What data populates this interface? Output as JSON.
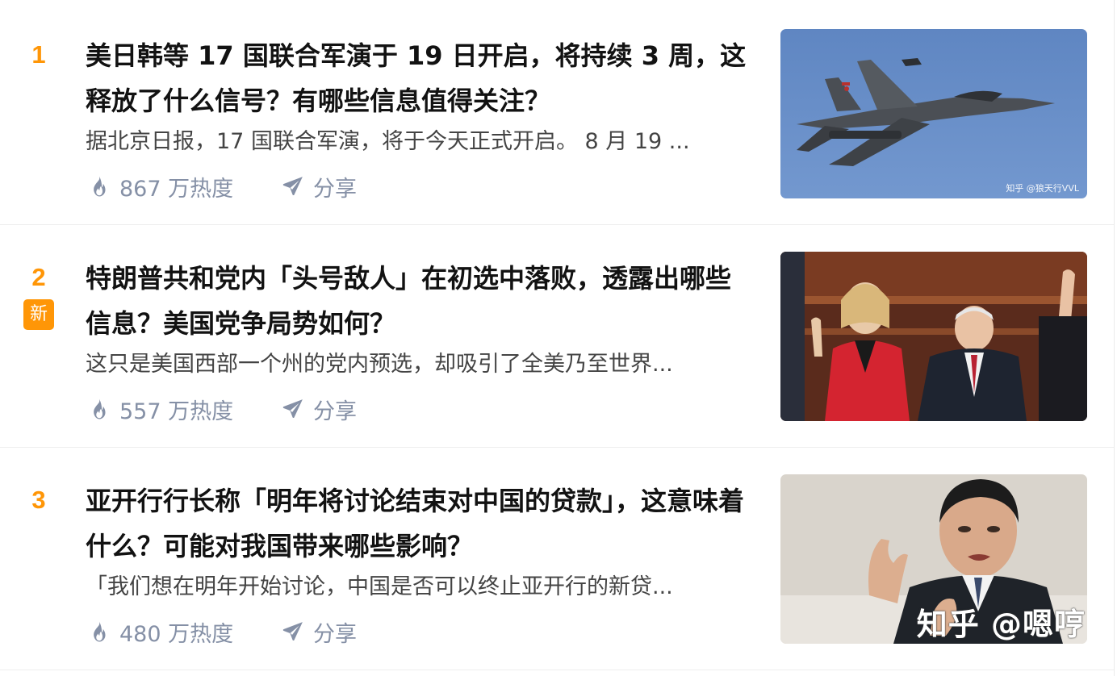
{
  "items": [
    {
      "rank": "1",
      "title": "美日韩等 17 国联合军演于 19 日开启，将持续 3 周，这释放了什么信号？有哪些信息值得关注？",
      "excerpt": "据北京日报，17 国联合军演，将于今天正式开启。 8 月 19 ...",
      "heat": "867 万热度",
      "share": "分享",
      "image_watermark": "知乎 @狼天行VVL"
    },
    {
      "rank": "2",
      "badge": "新",
      "title": "特朗普共和党内「头号敌人」在初选中落败，透露出哪些信息？美国党争局势如何？",
      "excerpt": "这只是美国西部一个州的党内预选，却吸引了全美乃至世界...",
      "heat": "557 万热度",
      "share": "分享"
    },
    {
      "rank": "3",
      "title": "亚开行行长称「明年将讨论结束对中国的贷款」，这意味着什么？可能对我国带来哪些影响？",
      "excerpt": "「我们想在明年开始讨论，中国是否可以终止亚开行的新贷...",
      "heat": "480 万热度",
      "share": "分享",
      "image_watermark": "知乎 @嗯哼"
    }
  ],
  "colors": {
    "rank": "#ff9607",
    "badge_bg": "#ff9607",
    "title": "#121212",
    "excerpt": "#444444",
    "meta": "#8590a6"
  },
  "icons": {
    "heat": "flame-icon",
    "share": "paper-plane-icon"
  }
}
